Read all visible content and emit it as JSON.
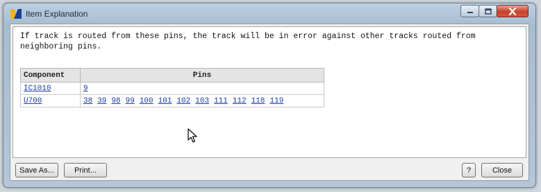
{
  "window": {
    "title": "Item Explanation",
    "icon": "app-logo-icon",
    "controls": [
      "minimize-icon",
      "maximize-icon",
      "close-icon"
    ]
  },
  "message": "If track is routed from these pins, the track will be in error against other tracks routed from neighboring pins.",
  "table": {
    "headers": {
      "component": "Component",
      "pins": "Pins"
    },
    "rows": [
      {
        "component": "IC1010",
        "pins": [
          "9"
        ]
      },
      {
        "component": "U700",
        "pins": [
          "38",
          "39",
          "98",
          "99",
          "100",
          "101",
          "102",
          "103",
          "111",
          "112",
          "118",
          "119"
        ]
      }
    ]
  },
  "buttons": {
    "save_as": "Save As...",
    "print": "Print...",
    "help": "?",
    "close": "Close"
  },
  "colors": {
    "link": "#1a3aa8",
    "close_button": "#c7412a",
    "titlebar": "#bcd0e3"
  }
}
